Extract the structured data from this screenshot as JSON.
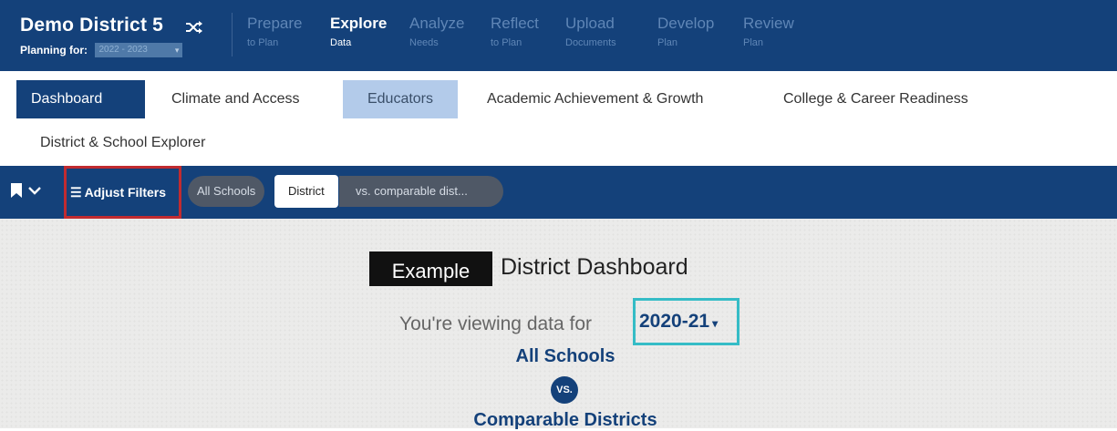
{
  "header": {
    "district_name": "Demo District 5",
    "planning_label": "Planning for:",
    "planning_year": "2022 - 2023",
    "steps": [
      {
        "label": "Prepare",
        "sub": "to Plan",
        "active": false
      },
      {
        "label": "Explore",
        "sub": "Data",
        "active": true
      },
      {
        "label": "Analyze",
        "sub": "Needs",
        "active": false
      },
      {
        "label": "Reflect",
        "sub": "to Plan",
        "active": false
      },
      {
        "label": "Upload",
        "sub": "Documents",
        "active": false
      },
      {
        "label": "Develop",
        "sub": "Plan",
        "active": false
      },
      {
        "label": "Review",
        "sub": "Plan",
        "active": false
      }
    ]
  },
  "tabs": [
    {
      "label": "Dashboard",
      "state": "selected"
    },
    {
      "label": "Climate and Access",
      "state": "normal"
    },
    {
      "label": "Educators",
      "state": "highlight"
    },
    {
      "label": "Academic Achievement & Growth",
      "state": "normal"
    },
    {
      "label": "College & Career Readiness",
      "state": "normal"
    },
    {
      "label": "District & School Explorer",
      "state": "normal"
    }
  ],
  "filters": {
    "adjust_label": "Adjust Filters",
    "pills": [
      "All Schools",
      "District",
      "vs. comparable dist..."
    ]
  },
  "main": {
    "badge": "Example",
    "title": "District Dashboard",
    "viewing_prefix": "You're viewing data for",
    "year": "2020-21",
    "group_a": "All Schools",
    "vs": "VS.",
    "group_b": "Comparable Districts"
  },
  "colors": {
    "brand_navy": "#14417a",
    "highlight_red": "#c12b30",
    "highlight_teal": "#35bcc6",
    "tab_highlight": "#b3cbea"
  },
  "icons": [
    "shuffle-icon",
    "bookmark-icon",
    "chevron-down-icon",
    "menu-icon",
    "dropdown-caret-icon"
  ]
}
